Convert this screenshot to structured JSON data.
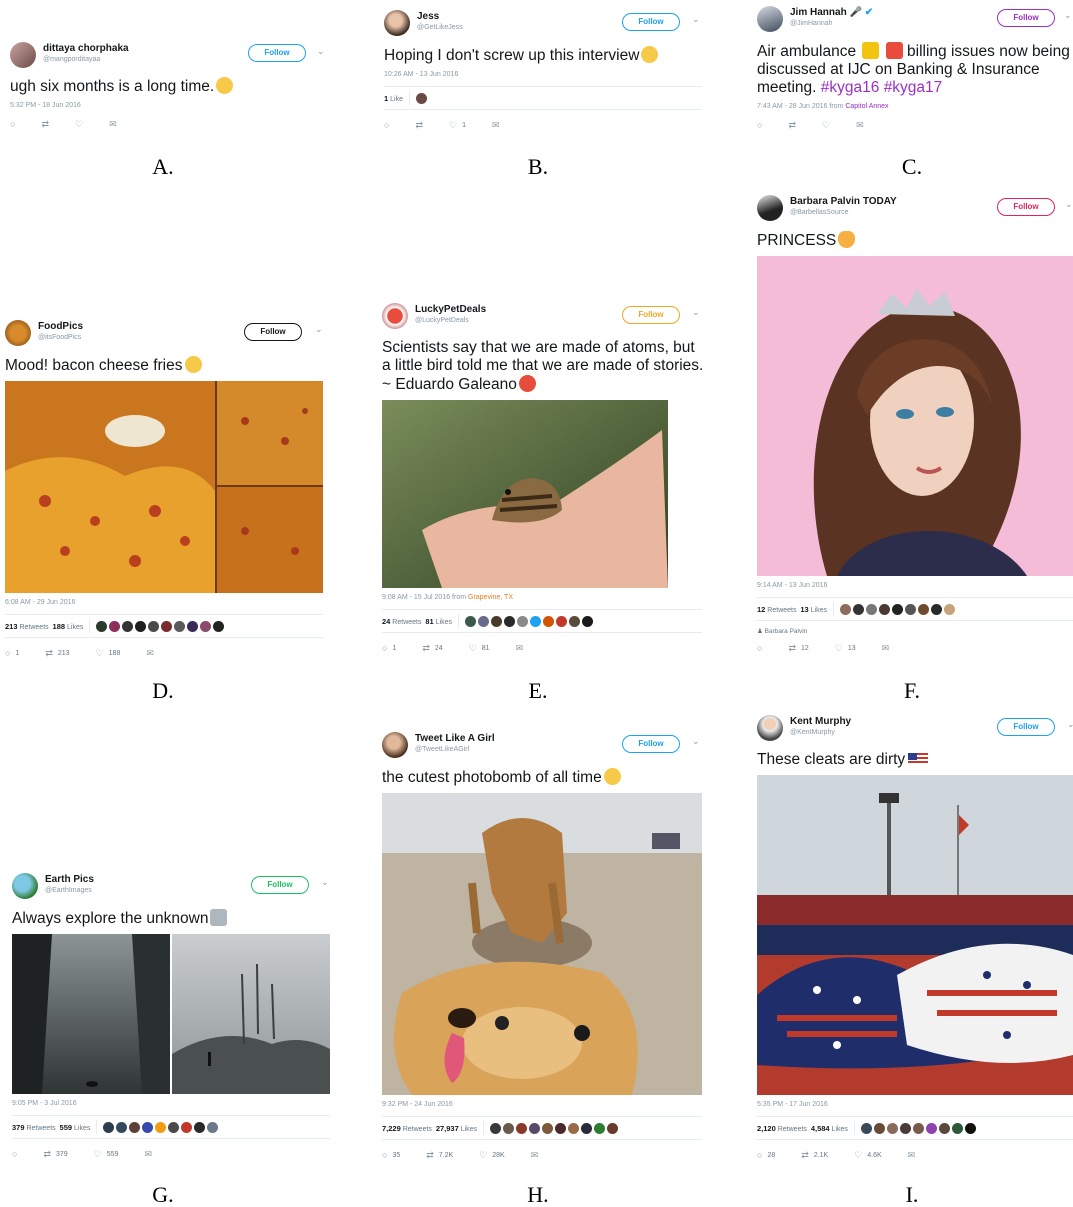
{
  "tweets": {
    "a": {
      "name": "dittaya chorphaka",
      "handle": "@mangporditayaa",
      "follow": "Follow",
      "text": "ugh six months is a long time.",
      "time": "5:32 PM - 18 Jun 2016",
      "caption": "A."
    },
    "b": {
      "name": "Jess",
      "handle": "@GetLikeJess",
      "follow": "Follow",
      "text": "Hoping I don't screw up this interview",
      "time": "10:26 AM - 13 Jun 2016",
      "likes_num": "1",
      "likes_label": "Like",
      "like_count": "1",
      "caption": "B."
    },
    "c": {
      "name": "Jim Hannah",
      "handle": "@JimHannah",
      "follow": "Follow",
      "text1": "Air ambulance",
      "text2": "billing issues now being discussed at IJC on Banking & Insurance meeting.",
      "hashtag1": "#kyga16",
      "hashtag2": "#kyga17",
      "time": "7:43 AM - 28 Jun 2016 from",
      "source": "Capitol Annex",
      "caption": "C."
    },
    "f": {
      "name": "Barbara Palvin TODAY",
      "handle": "@BarbellasSource",
      "follow": "Follow",
      "text": "PRINCESS",
      "time": "9:14 AM - 13 Jun 2016",
      "retweets_num": "12",
      "retweets_label": "Retweets",
      "likes_num": "13",
      "likes_label": "Likes",
      "liked_by": "Barbara Palvin",
      "retweet_count": "12",
      "like_count": "13",
      "caption": "F."
    },
    "d": {
      "name": "FoodPics",
      "handle": "@itsFoodPics",
      "follow": "Follow",
      "text": "Mood! bacon cheese fries",
      "time": "6:08 AM - 29 Jun 2016",
      "retweets_num": "213",
      "retweets_label": "Retweets",
      "likes_num": "188",
      "likes_label": "Likes",
      "reply_count": "1",
      "retweet_count": "213",
      "like_count": "188",
      "caption": "D."
    },
    "e": {
      "name": "LuckyPetDeals",
      "handle": "@LuckyPetDeals",
      "follow": "Follow",
      "text": "Scientists say that we are made of atoms, but a little bird told me that we are made of stories. ~ Eduardo Galeano",
      "time": "9:08 AM - 15 Jul 2016 from",
      "source": "Grapevine, TX",
      "retweets_num": "24",
      "retweets_label": "Retweets",
      "likes_num": "81",
      "likes_label": "Likes",
      "reply_count": "1",
      "retweet_count": "24",
      "like_count": "81",
      "caption": "E."
    },
    "g": {
      "name": "Earth Pics",
      "handle": "@EarthImages",
      "follow": "Follow",
      "text": "Always explore the unknown",
      "time": "9:05 PM - 3 Jul 2016",
      "retweets_num": "379",
      "retweets_label": "Retweets",
      "likes_num": "559",
      "likes_label": "Likes",
      "retweet_count": "379",
      "like_count": "559",
      "caption": "G."
    },
    "h": {
      "name": "Tweet Like A Girl",
      "handle": "@TweetLikeAGirl",
      "follow": "Follow",
      "text": "the cutest photobomb of all time",
      "time": "9:32 PM - 24 Jun 2016",
      "retweets_num": "7,229",
      "retweets_label": "Retweets",
      "likes_num": "27,937",
      "likes_label": "Likes",
      "reply_count": "35",
      "retweet_count": "7.2K",
      "like_count": "28K",
      "caption": "H."
    },
    "i": {
      "name": "Kent Murphy",
      "handle": "@KentMurphy",
      "follow": "Follow",
      "text": "These cleats are dirty",
      "time": "5:35 PM - 17 Jun 2016",
      "retweets_num": "2,120",
      "retweets_label": "Retweets",
      "likes_num": "4,584",
      "likes_label": "Likes",
      "reply_count": "28",
      "retweet_count": "2.1K",
      "like_count": "4.6K",
      "caption": "I."
    }
  },
  "icons": {
    "reply": "○",
    "retweet": "⇄",
    "like": "♡",
    "dm": "✉",
    "chevron": "⌄",
    "person": "♟"
  },
  "colors": {
    "accent": "#1da1f2",
    "follow_red": "#e0245e",
    "follow_orange": "#f5a623",
    "follow_green": "#17bf63",
    "hashtag": "#9b2fc7"
  }
}
